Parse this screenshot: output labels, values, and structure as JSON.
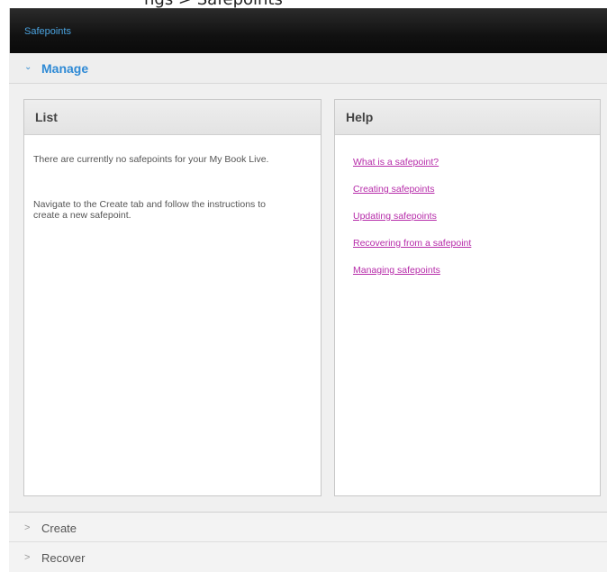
{
  "top_crop": {
    "text": "ngs > Safepoints"
  },
  "window": {
    "title": "Safepoints"
  },
  "sections": {
    "manage": {
      "chevron": "⌄",
      "label": "Manage"
    },
    "create": {
      "chevron": ">",
      "label": "Create"
    },
    "recover": {
      "chevron": ">",
      "label": "Recover"
    }
  },
  "list_panel": {
    "title": "List",
    "message_1": "There are currently no safepoints for your My Book Live.",
    "message_2": "Navigate to the Create tab and follow the instructions to create a new safepoint."
  },
  "help_panel": {
    "title": "Help",
    "links": [
      "What is a safepoint?",
      "Creating safepoints",
      "Updating safepoints",
      "Recovering from a safepoint",
      "Managing safepoints"
    ]
  },
  "colors": {
    "link": "#b62ba9",
    "accent": "#2f8ad5",
    "titlebar": "#111111"
  }
}
